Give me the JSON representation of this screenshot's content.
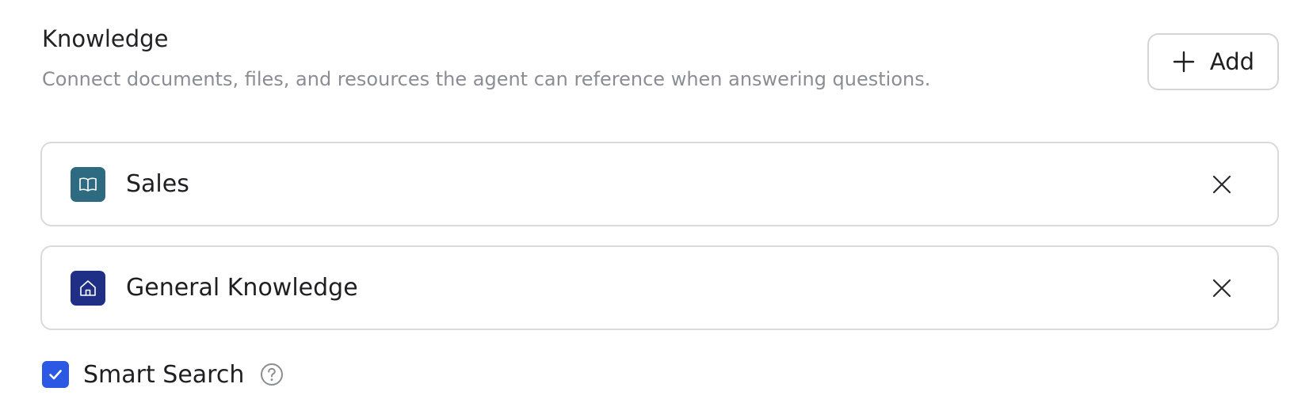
{
  "section": {
    "title": "Knowledge",
    "description": "Connect documents, files, and resources the agent can reference when answering questions."
  },
  "add_button": {
    "label": "Add",
    "icon": "plus-icon"
  },
  "knowledge_items": [
    {
      "name": "Sales",
      "icon": "book-icon",
      "icon_color": "#2f6b80"
    },
    {
      "name": "General Knowledge",
      "icon": "home-icon",
      "icon_color": "#1f2f85"
    }
  ],
  "smart_search": {
    "label": "Smart Search",
    "checked": true,
    "checkbox_color": "#2b59e3",
    "help_icon": "question-circle-icon"
  }
}
